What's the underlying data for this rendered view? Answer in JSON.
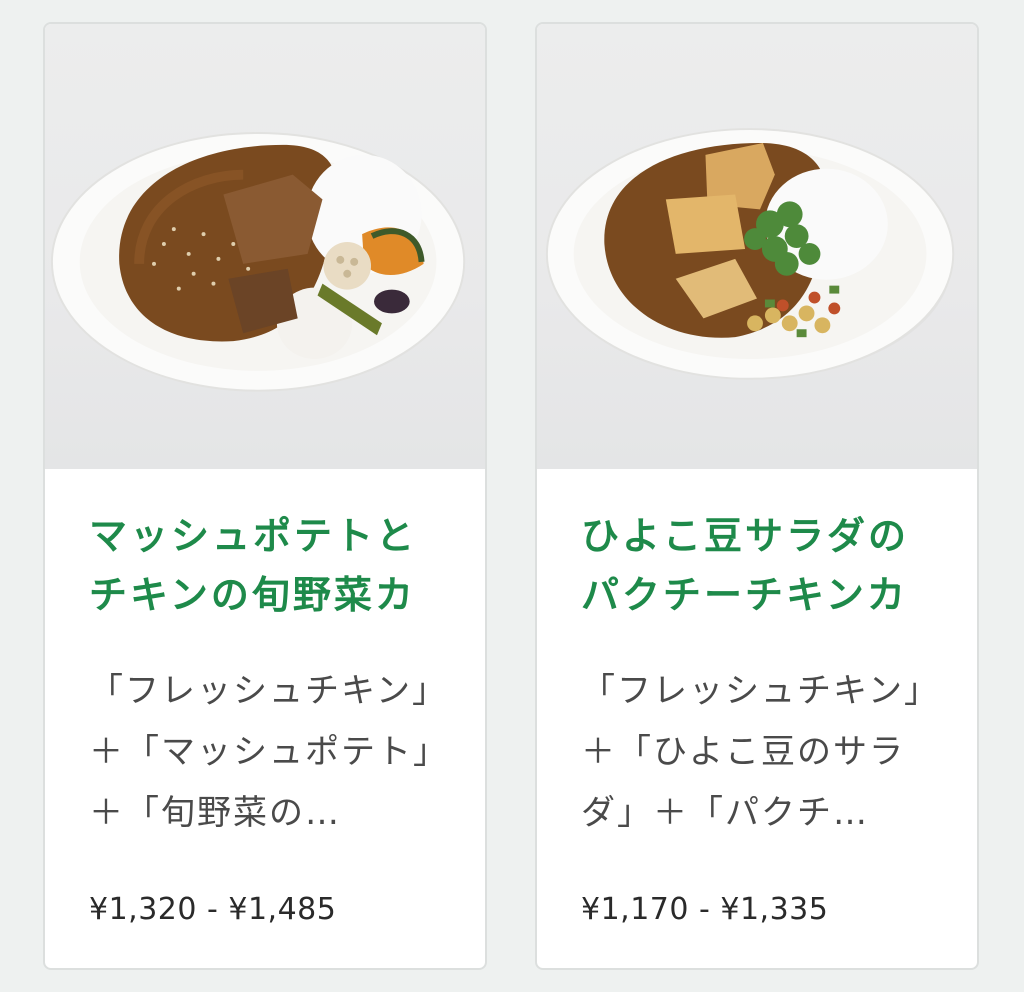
{
  "menu_items": [
    {
      "title": "マッシュポテトとチキンの旬野菜カレー",
      "description": "「フレッシュチキン」＋「マッシュポテト」＋「旬野菜の…",
      "price": "¥1,320 - ¥1,485"
    },
    {
      "title": "ひよこ豆サラダのパクチーチキンカレー",
      "description": "「フレッシュチキン」＋「ひよこ豆のサラダ」＋「パクチ…",
      "price": "¥1,170 - ¥1,335"
    }
  ],
  "colors": {
    "title_green": "#1e8a4a",
    "background": "#eef1f0",
    "card": "#ffffff",
    "curry": "#7a4a1f"
  }
}
